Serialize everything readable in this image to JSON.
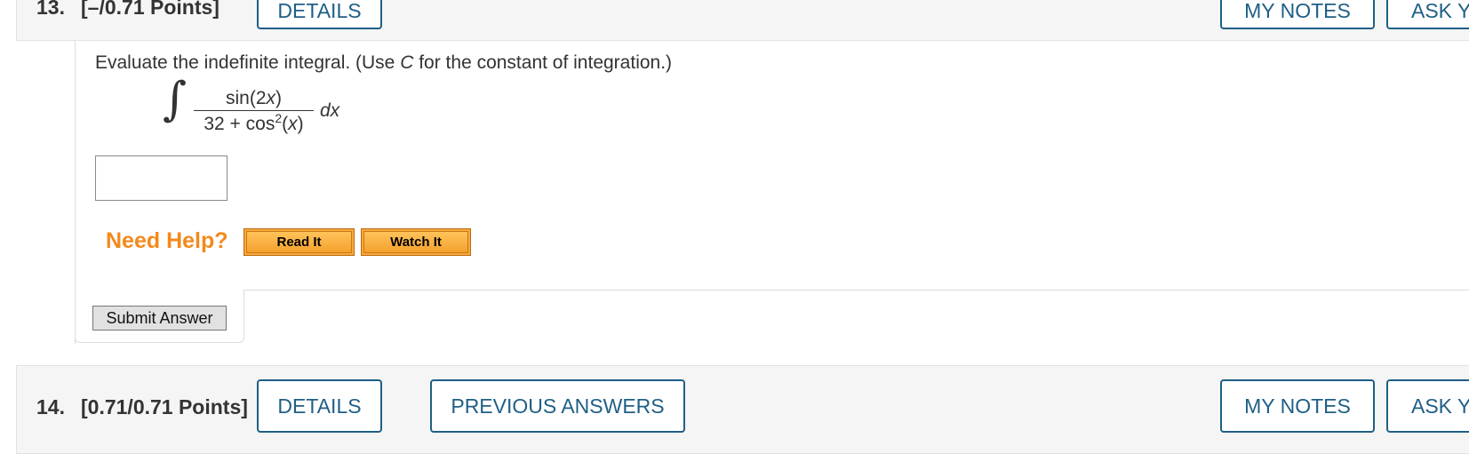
{
  "question_13": {
    "number": "13.",
    "points": "[–/0.71 Points]",
    "buttons": {
      "details": "DETAILS",
      "my_notes": "MY NOTES",
      "ask": "ASK Y"
    },
    "prompt": {
      "before": "Evaluate the indefinite integral. (Use ",
      "var": "C",
      "after": " for the constant of integration.)"
    },
    "integral": {
      "sign": "∫",
      "numerator": {
        "fn": "sin(2",
        "var": "x",
        "close": ")"
      },
      "denominator": {
        "lead": "32 + cos",
        "exp": "2",
        "open": "(",
        "var": "x",
        "close": ")"
      },
      "differential": "dx"
    },
    "answer": {
      "value": "",
      "placeholder": ""
    },
    "help": {
      "label": "Need Help?",
      "read_it": "Read It",
      "watch_it": "Watch It"
    },
    "submit_label": "Submit Answer"
  },
  "question_14": {
    "number": "14.",
    "points": "[0.71/0.71 Points]",
    "buttons": {
      "details": "DETAILS",
      "previous_answers": "PREVIOUS ANSWERS",
      "my_notes": "MY NOTES",
      "ask": "ASK Y"
    }
  },
  "colors": {
    "button_border": "#1f5f86",
    "need_help": "#f28a1c",
    "help_button": "#f9a83a",
    "header_bg": "#f5f5f5"
  }
}
